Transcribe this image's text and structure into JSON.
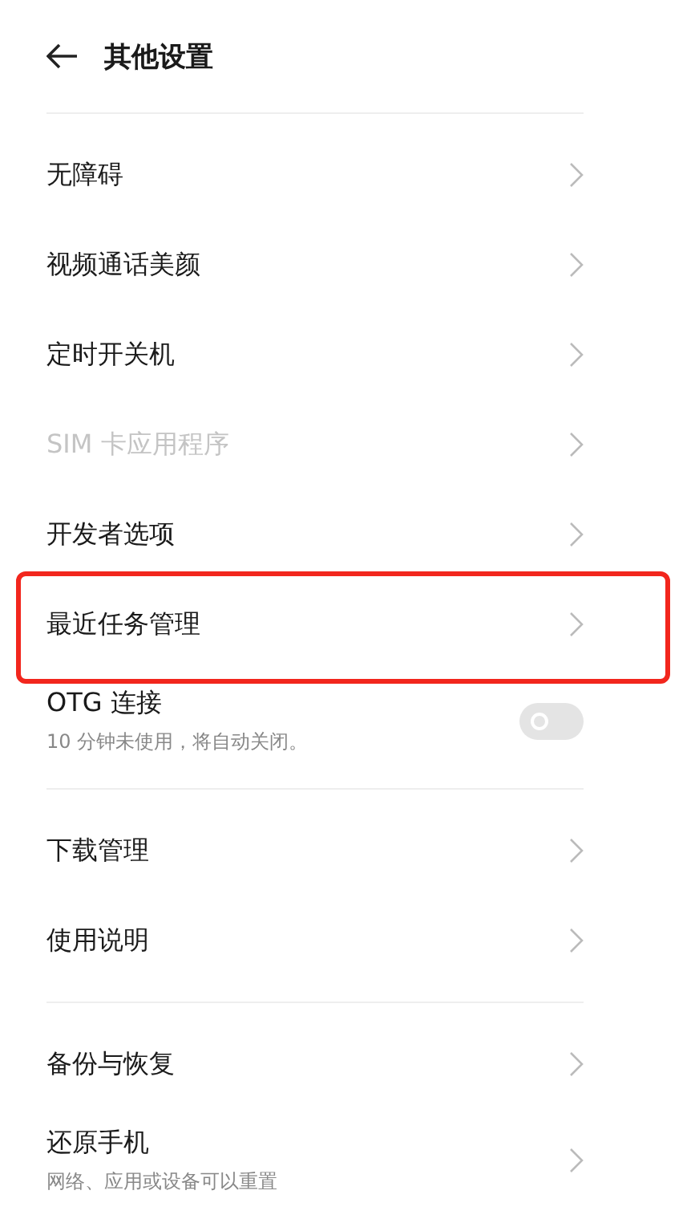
{
  "header": {
    "title": "其他设置"
  },
  "groups": [
    {
      "items": [
        {
          "kind": "link",
          "label": "无障碍",
          "disabled": false
        },
        {
          "kind": "link",
          "label": "视频通话美颜",
          "disabled": false
        },
        {
          "kind": "link",
          "label": "定时开关机",
          "disabled": false
        },
        {
          "kind": "link",
          "label": "SIM 卡应用程序",
          "disabled": true
        },
        {
          "kind": "link",
          "label": "开发者选项",
          "disabled": false
        },
        {
          "kind": "link",
          "label": "最近任务管理",
          "disabled": false,
          "highlighted": true
        },
        {
          "kind": "switch",
          "label": "OTG 连接",
          "subtitle": "10 分钟未使用，将自动关闭。",
          "on": false,
          "disabled": false
        }
      ]
    },
    {
      "items": [
        {
          "kind": "link",
          "label": "下载管理",
          "disabled": false
        },
        {
          "kind": "link",
          "label": "使用说明",
          "disabled": false
        }
      ]
    },
    {
      "items": [
        {
          "kind": "link",
          "label": "备份与恢复",
          "disabled": false
        },
        {
          "kind": "link",
          "label": "还原手机",
          "subtitle": "网络、应用或设备可以重置",
          "disabled": false
        }
      ]
    }
  ]
}
